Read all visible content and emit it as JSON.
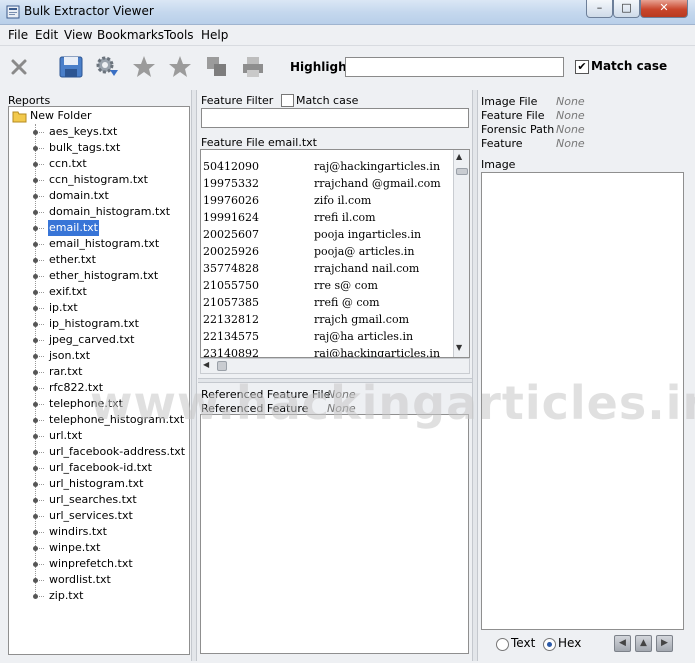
{
  "window": {
    "title": "Bulk Extractor Viewer"
  },
  "menu": [
    "File",
    "Edit",
    "View",
    "Bookmarks",
    "Tools",
    "Help"
  ],
  "toolbar": {
    "icons": [
      "close-icon",
      "save-icon",
      "gear-icon",
      "star-add-icon",
      "star-icon",
      "copy-icon",
      "print-icon"
    ],
    "highlight_label": "Highlight:",
    "highlight_value": "",
    "match_case_label": "Match case",
    "match_case_checked": true,
    "check_mark": "✔"
  },
  "reports": {
    "label": "Reports",
    "folder": "New Folder",
    "selected": "email.txt",
    "items": [
      "aes_keys.txt",
      "bulk_tags.txt",
      "ccn.txt",
      "ccn_histogram.txt",
      "domain.txt",
      "domain_histogram.txt",
      "email.txt",
      "email_histogram.txt",
      "ether.txt",
      "ether_histogram.txt",
      "exif.txt",
      "ip.txt",
      "ip_histogram.txt",
      "jpeg_carved.txt",
      "json.txt",
      "rar.txt",
      "rfc822.txt",
      "telephone.txt",
      "telephone_histogram.txt",
      "url.txt",
      "url_facebook-address.txt",
      "url_facebook-id.txt",
      "url_histogram.txt",
      "url_searches.txt",
      "url_services.txt",
      "windirs.txt",
      "winpe.txt",
      "winprefetch.txt",
      "wordlist.txt",
      "zip.txt"
    ]
  },
  "feature_filter": {
    "label": "Feature Filter",
    "match_case_label": "Match case",
    "value": ""
  },
  "feature_file": {
    "label": "Feature File",
    "value": "email.txt",
    "rows": [
      {
        "offset": "50412090",
        "feature": "raj@hackingarticles.in"
      },
      {
        "offset": "19975332",
        "feature": "rrajchand    @gmail.com"
      },
      {
        "offset": "19976026",
        "feature": "zifo          il.com"
      },
      {
        "offset": "19991624",
        "feature": "rrefi          il.com"
      },
      {
        "offset": "20025607",
        "feature": "pooja        ingarticles.in"
      },
      {
        "offset": "20025926",
        "feature": "pooja@       articles.in"
      },
      {
        "offset": "35774828",
        "feature": "rrajchand     nail.com"
      },
      {
        "offset": "21055750",
        "feature": "rre    s@     com"
      },
      {
        "offset": "21057385",
        "feature": "rrefi   @      com"
      },
      {
        "offset": "22132812",
        "feature": "rrajch        gmail.com"
      },
      {
        "offset": "22134575",
        "feature": "raj@ha       articles.in"
      },
      {
        "offset": "23140892",
        "feature": "raj@hackingarticles.in"
      }
    ]
  },
  "referenced": {
    "file_label": "Referenced Feature File",
    "file_value": "None",
    "feature_label": "Referenced Feature",
    "feature_value": "None"
  },
  "meta": {
    "image_file_label": "Image File",
    "image_file_value": "None",
    "feature_file_label": "Feature File",
    "feature_file_value": "None",
    "forensic_path_label": "Forensic Path",
    "forensic_path_value": "None",
    "feature_label": "Feature",
    "feature_value": "None",
    "image_label": "Image"
  },
  "view_mode": {
    "text_label": "Text",
    "hex_label": "Hex",
    "selected": "Hex"
  },
  "watermark": "www.hackingarticles.in"
}
